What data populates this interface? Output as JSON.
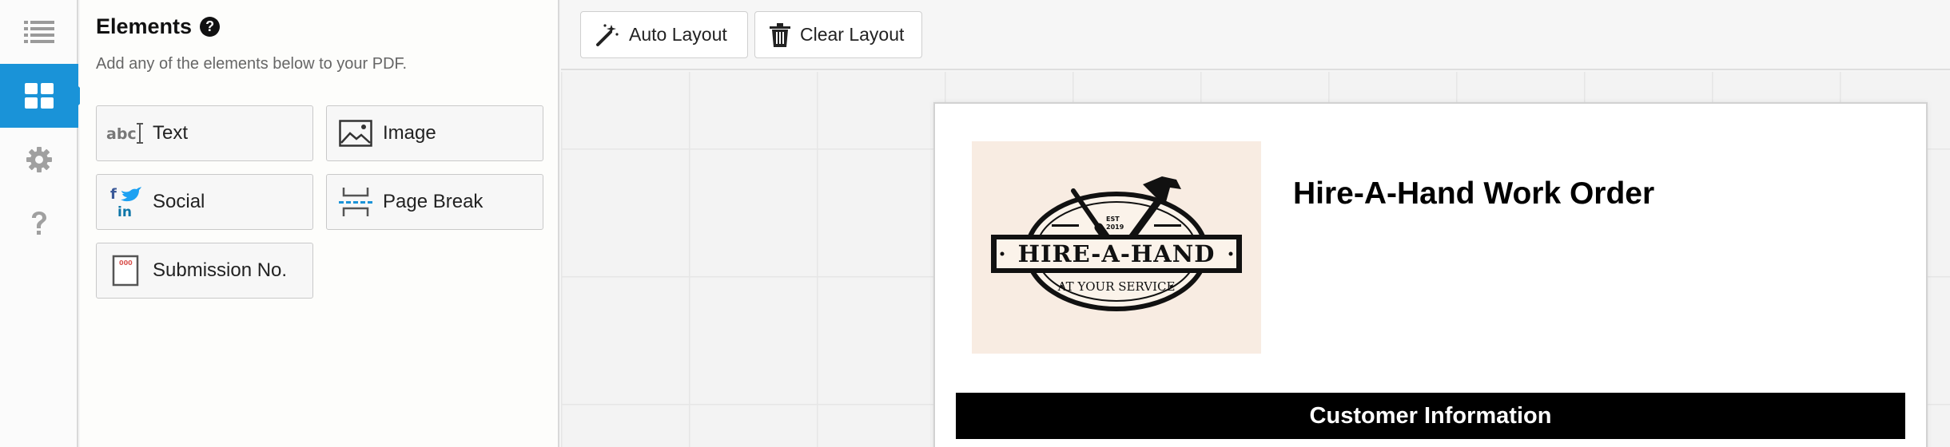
{
  "rail": {
    "items": [
      {
        "icon": "list-icon",
        "active": false
      },
      {
        "icon": "grid-icon",
        "active": true
      },
      {
        "icon": "gear-icon",
        "active": false
      },
      {
        "icon": "help-icon",
        "active": false
      }
    ]
  },
  "panel": {
    "title": "Elements",
    "subtitle": "Add any of the elements below to your PDF.",
    "elements": [
      {
        "label": "Text",
        "icon": "text-abc-icon"
      },
      {
        "label": "Image",
        "icon": "image-icon"
      },
      {
        "label": "Social",
        "icon": "social-icon"
      },
      {
        "label": "Page Break",
        "icon": "page-break-icon"
      },
      {
        "label": "Submission No.",
        "icon": "submission-number-icon"
      }
    ]
  },
  "toolbar": {
    "auto_layout": "Auto Layout",
    "clear_layout": "Clear Layout"
  },
  "document": {
    "title": "Hire-A-Hand Work Order",
    "section_header": "Customer Information",
    "logo": {
      "brand": "HIRE-A-HAND",
      "tagline": "AT YOUR SERVICE",
      "est": "EST",
      "year": "2019"
    }
  },
  "colors": {
    "accent": "#1a93d8",
    "logo_background": "#f8ece2",
    "section_bar": "#000000"
  }
}
